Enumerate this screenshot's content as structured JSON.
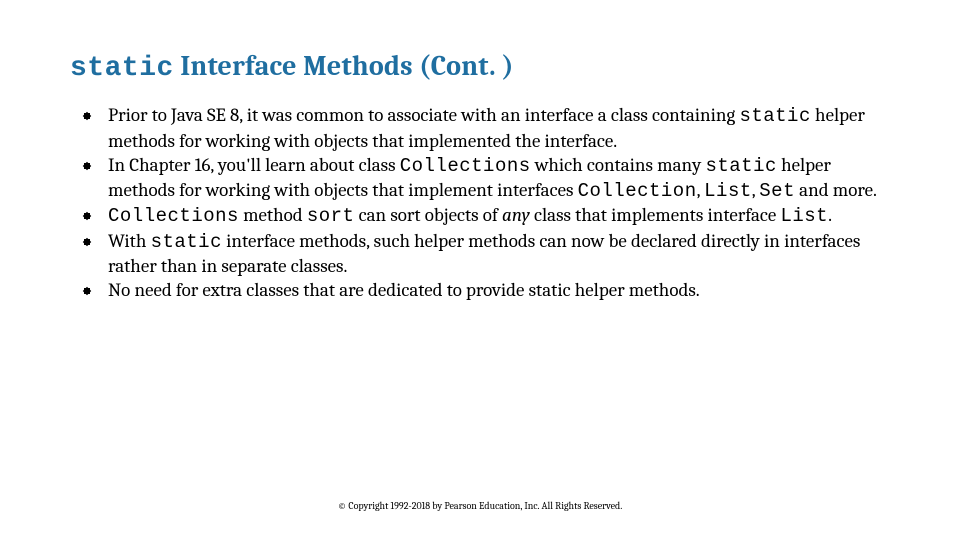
{
  "title": {
    "code_part": "static",
    "rest": " Interface Methods (Cont. )"
  },
  "bullets": [
    {
      "segments": [
        {
          "t": "Prior to Java SE 8, it was common to associate with an interface a class containing "
        },
        {
          "t": "static",
          "cls": "code"
        },
        {
          "t": " helper methods for working with objects that implemented the interface."
        }
      ]
    },
    {
      "segments": [
        {
          "t": "In Chapter 16, you'll learn about class "
        },
        {
          "t": "Collections",
          "cls": "code"
        },
        {
          "t": " which contains many "
        },
        {
          "t": "static",
          "cls": "code"
        },
        {
          "t": " helper methods for working with objects that implement interfaces "
        },
        {
          "t": "Collection",
          "cls": "code"
        },
        {
          "t": ", "
        },
        {
          "t": "List",
          "cls": "code"
        },
        {
          "t": ", "
        },
        {
          "t": "Set",
          "cls": "code"
        },
        {
          "t": " and more."
        }
      ]
    },
    {
      "segments": [
        {
          "t": "Collections",
          "cls": "code"
        },
        {
          "t": " method "
        },
        {
          "t": "sort",
          "cls": "code"
        },
        {
          "t": " can sort objects of "
        },
        {
          "t": "any",
          "cls": "italic"
        },
        {
          "t": " class that implements interface "
        },
        {
          "t": "List",
          "cls": "code"
        },
        {
          "t": "."
        }
      ]
    },
    {
      "segments": [
        {
          "t": "With "
        },
        {
          "t": "static",
          "cls": "code"
        },
        {
          "t": " interface methods, such helper methods can now be declared directly in interfaces rather than in separate classes."
        }
      ]
    },
    {
      "segments": [
        {
          "t": "No need for extra classes that are dedicated to provide static helper methods."
        }
      ]
    }
  ],
  "footer": "© Copyright 1992-2018 by Pearson Education, Inc. All Rights Reserved."
}
